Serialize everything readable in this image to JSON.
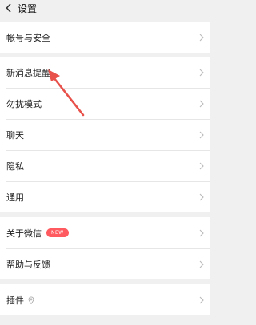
{
  "header": {
    "title": "设置"
  },
  "groups": {
    "account": {
      "items": [
        {
          "label": "帐号与安全"
        }
      ]
    },
    "main": {
      "items": [
        {
          "label": "新消息提醒"
        },
        {
          "label": "勿扰模式"
        },
        {
          "label": "聊天"
        },
        {
          "label": "隐私"
        },
        {
          "label": "通用"
        }
      ]
    },
    "about": {
      "items": [
        {
          "label": "关于微信",
          "badge": "NEW"
        },
        {
          "label": "帮助与反馈"
        }
      ]
    },
    "plugins": {
      "items": [
        {
          "label": "插件"
        }
      ]
    }
  },
  "colors": {
    "badge": "#ff5a5f",
    "annotation_arrow": "#e8504a",
    "background": "#f0f0f0"
  },
  "icons": {
    "back": "chevron-left-icon",
    "row_arrow": "chevron-right-icon",
    "plugin": "location-pin-icon"
  }
}
